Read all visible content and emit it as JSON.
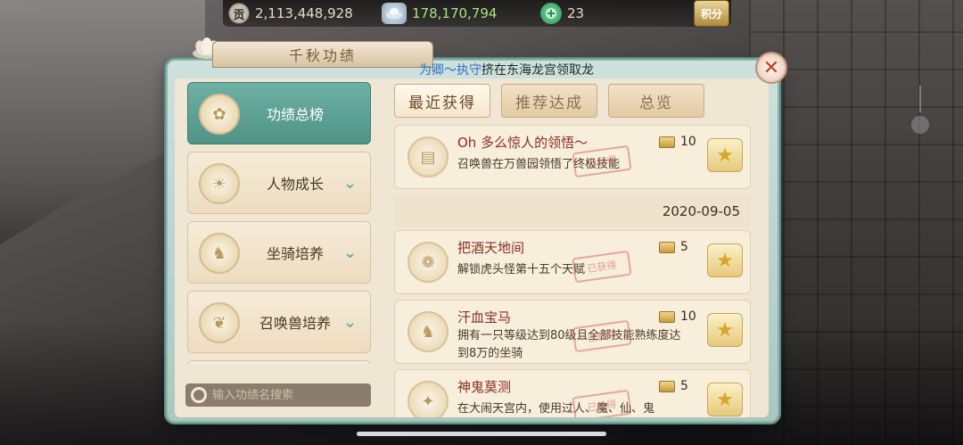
{
  "currencies": [
    {
      "icon": "tribute-coin-icon",
      "glyph": "贡",
      "value": "2,113,448,928"
    },
    {
      "icon": "silver-ingot-icon",
      "glyph": "",
      "value": "178,170,794"
    },
    {
      "icon": "jade-icon",
      "glyph": "",
      "value": "23"
    }
  ],
  "score_badge": "积分",
  "panel": {
    "title": "千秋功绩",
    "broadcast": {
      "who": "为卿～执守",
      "text": "挤在东海龙宫领取龙"
    }
  },
  "sidebar": {
    "items": [
      {
        "label": "功绩总榜",
        "active": true,
        "icon": "ranking-icon"
      },
      {
        "label": "人物成长",
        "active": false,
        "icon": "character-growth-icon"
      },
      {
        "label": "坐骑培养",
        "active": false,
        "icon": "mount-icon"
      },
      {
        "label": "召唤兽培养",
        "active": false,
        "icon": "summon-beast-icon"
      }
    ],
    "search_placeholder": "输入功绩名搜索"
  },
  "tabs": [
    {
      "label": "最近获得",
      "active": true
    },
    {
      "label": "推荐达成",
      "active": false
    },
    {
      "label": "总览",
      "active": false
    }
  ],
  "achievements": {
    "top": {
      "title": "Oh 多么惊人的领悟～",
      "desc": "召唤兽在万兽园领悟了终极技能",
      "points": "10",
      "stamp": "已获得"
    },
    "date": "2020-09-05",
    "items": [
      {
        "title": "把酒天地间",
        "desc": "解锁虎头怪第十五个天赋",
        "points": "5",
        "stamp": "已获得"
      },
      {
        "title": "汗血宝马",
        "desc": "拥有一只等级达到80级且全部技能熟练度达到8万的坐骑",
        "points": "10",
        "stamp": "已获得"
      },
      {
        "title": "神鬼莫测",
        "desc": "在大闹天宫内，使用过人、魔、仙、鬼",
        "points": "5",
        "stamp": "已获得"
      }
    ]
  },
  "colors": {
    "accent_teal": "#4f9487",
    "title_red": "#8a2f25",
    "silver_green": "#a6e57a"
  }
}
